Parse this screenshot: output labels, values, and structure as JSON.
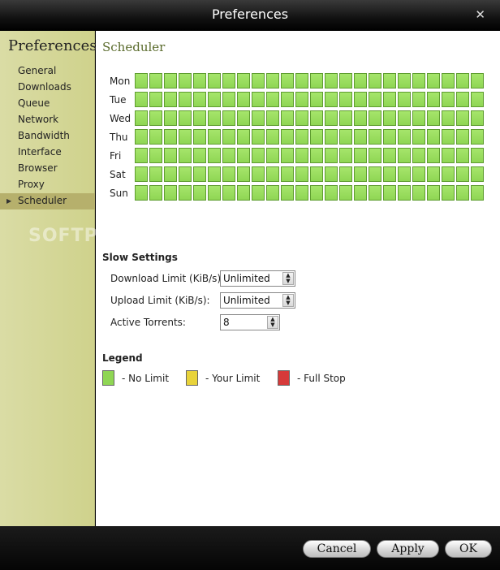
{
  "window": {
    "title": "Preferences",
    "close_glyph": "✕"
  },
  "sidebar": {
    "header": "Preferences",
    "items": [
      {
        "label": "General"
      },
      {
        "label": "Downloads"
      },
      {
        "label": "Queue"
      },
      {
        "label": "Network"
      },
      {
        "label": "Bandwidth"
      },
      {
        "label": "Interface"
      },
      {
        "label": "Browser"
      },
      {
        "label": "Proxy"
      },
      {
        "label": "Scheduler",
        "selected": true
      }
    ],
    "watermark": "SOFTPEDIA"
  },
  "scheduler": {
    "title": "Scheduler",
    "days": [
      "Mon",
      "Tue",
      "Wed",
      "Thu",
      "Fri",
      "Sat",
      "Sun"
    ],
    "hours_per_day": 24,
    "cell_state": "No Limit"
  },
  "slow_settings": {
    "title": "Slow Settings",
    "download_label": "Download Limit (KiB/s):",
    "download_value": "Unlimited",
    "upload_label": "Upload Limit (KiB/s):",
    "upload_value": "Unlimited",
    "torrents_label": "Active Torrents:",
    "torrents_value": "8"
  },
  "legend": {
    "title": "Legend",
    "items": [
      {
        "label": "- No Limit",
        "color": "#8fd654"
      },
      {
        "label": "- Your Limit",
        "color": "#e8d33a"
      },
      {
        "label": "- Full Stop",
        "color": "#d63a3a"
      }
    ]
  },
  "buttons": {
    "cancel": "Cancel",
    "apply": "Apply",
    "ok": "OK"
  }
}
